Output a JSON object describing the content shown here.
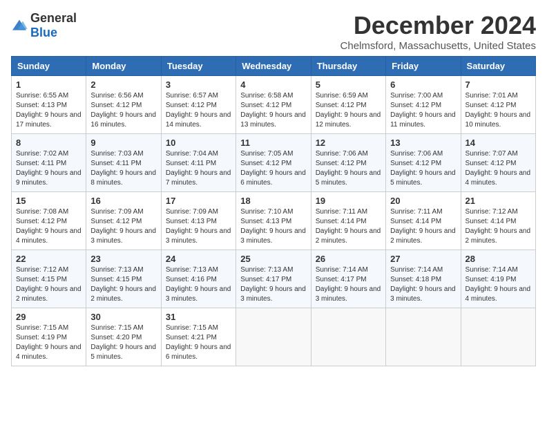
{
  "logo": {
    "general": "General",
    "blue": "Blue"
  },
  "title": "December 2024",
  "subtitle": "Chelmsford, Massachusetts, United States",
  "headers": [
    "Sunday",
    "Monday",
    "Tuesday",
    "Wednesday",
    "Thursday",
    "Friday",
    "Saturday"
  ],
  "weeks": [
    [
      {
        "day": "1",
        "sunrise": "6:55 AM",
        "sunset": "4:13 PM",
        "daylight": "9 hours and 17 minutes."
      },
      {
        "day": "2",
        "sunrise": "6:56 AM",
        "sunset": "4:12 PM",
        "daylight": "9 hours and 16 minutes."
      },
      {
        "day": "3",
        "sunrise": "6:57 AM",
        "sunset": "4:12 PM",
        "daylight": "9 hours and 14 minutes."
      },
      {
        "day": "4",
        "sunrise": "6:58 AM",
        "sunset": "4:12 PM",
        "daylight": "9 hours and 13 minutes."
      },
      {
        "day": "5",
        "sunrise": "6:59 AM",
        "sunset": "4:12 PM",
        "daylight": "9 hours and 12 minutes."
      },
      {
        "day": "6",
        "sunrise": "7:00 AM",
        "sunset": "4:12 PM",
        "daylight": "9 hours and 11 minutes."
      },
      {
        "day": "7",
        "sunrise": "7:01 AM",
        "sunset": "4:12 PM",
        "daylight": "9 hours and 10 minutes."
      }
    ],
    [
      {
        "day": "8",
        "sunrise": "7:02 AM",
        "sunset": "4:11 PM",
        "daylight": "9 hours and 9 minutes."
      },
      {
        "day": "9",
        "sunrise": "7:03 AM",
        "sunset": "4:11 PM",
        "daylight": "9 hours and 8 minutes."
      },
      {
        "day": "10",
        "sunrise": "7:04 AM",
        "sunset": "4:11 PM",
        "daylight": "9 hours and 7 minutes."
      },
      {
        "day": "11",
        "sunrise": "7:05 AM",
        "sunset": "4:12 PM",
        "daylight": "9 hours and 6 minutes."
      },
      {
        "day": "12",
        "sunrise": "7:06 AM",
        "sunset": "4:12 PM",
        "daylight": "9 hours and 5 minutes."
      },
      {
        "day": "13",
        "sunrise": "7:06 AM",
        "sunset": "4:12 PM",
        "daylight": "9 hours and 5 minutes."
      },
      {
        "day": "14",
        "sunrise": "7:07 AM",
        "sunset": "4:12 PM",
        "daylight": "9 hours and 4 minutes."
      }
    ],
    [
      {
        "day": "15",
        "sunrise": "7:08 AM",
        "sunset": "4:12 PM",
        "daylight": "9 hours and 4 minutes."
      },
      {
        "day": "16",
        "sunrise": "7:09 AM",
        "sunset": "4:12 PM",
        "daylight": "9 hours and 3 minutes."
      },
      {
        "day": "17",
        "sunrise": "7:09 AM",
        "sunset": "4:13 PM",
        "daylight": "9 hours and 3 minutes."
      },
      {
        "day": "18",
        "sunrise": "7:10 AM",
        "sunset": "4:13 PM",
        "daylight": "9 hours and 3 minutes."
      },
      {
        "day": "19",
        "sunrise": "7:11 AM",
        "sunset": "4:14 PM",
        "daylight": "9 hours and 2 minutes."
      },
      {
        "day": "20",
        "sunrise": "7:11 AM",
        "sunset": "4:14 PM",
        "daylight": "9 hours and 2 minutes."
      },
      {
        "day": "21",
        "sunrise": "7:12 AM",
        "sunset": "4:14 PM",
        "daylight": "9 hours and 2 minutes."
      }
    ],
    [
      {
        "day": "22",
        "sunrise": "7:12 AM",
        "sunset": "4:15 PM",
        "daylight": "9 hours and 2 minutes."
      },
      {
        "day": "23",
        "sunrise": "7:13 AM",
        "sunset": "4:15 PM",
        "daylight": "9 hours and 2 minutes."
      },
      {
        "day": "24",
        "sunrise": "7:13 AM",
        "sunset": "4:16 PM",
        "daylight": "9 hours and 3 minutes."
      },
      {
        "day": "25",
        "sunrise": "7:13 AM",
        "sunset": "4:17 PM",
        "daylight": "9 hours and 3 minutes."
      },
      {
        "day": "26",
        "sunrise": "7:14 AM",
        "sunset": "4:17 PM",
        "daylight": "9 hours and 3 minutes."
      },
      {
        "day": "27",
        "sunrise": "7:14 AM",
        "sunset": "4:18 PM",
        "daylight": "9 hours and 3 minutes."
      },
      {
        "day": "28",
        "sunrise": "7:14 AM",
        "sunset": "4:19 PM",
        "daylight": "9 hours and 4 minutes."
      }
    ],
    [
      {
        "day": "29",
        "sunrise": "7:15 AM",
        "sunset": "4:19 PM",
        "daylight": "9 hours and 4 minutes."
      },
      {
        "day": "30",
        "sunrise": "7:15 AM",
        "sunset": "4:20 PM",
        "daylight": "9 hours and 5 minutes."
      },
      {
        "day": "31",
        "sunrise": "7:15 AM",
        "sunset": "4:21 PM",
        "daylight": "9 hours and 6 minutes."
      },
      null,
      null,
      null,
      null
    ]
  ],
  "labels": {
    "sunrise": "Sunrise:",
    "sunset": "Sunset:",
    "daylight": "Daylight:"
  }
}
